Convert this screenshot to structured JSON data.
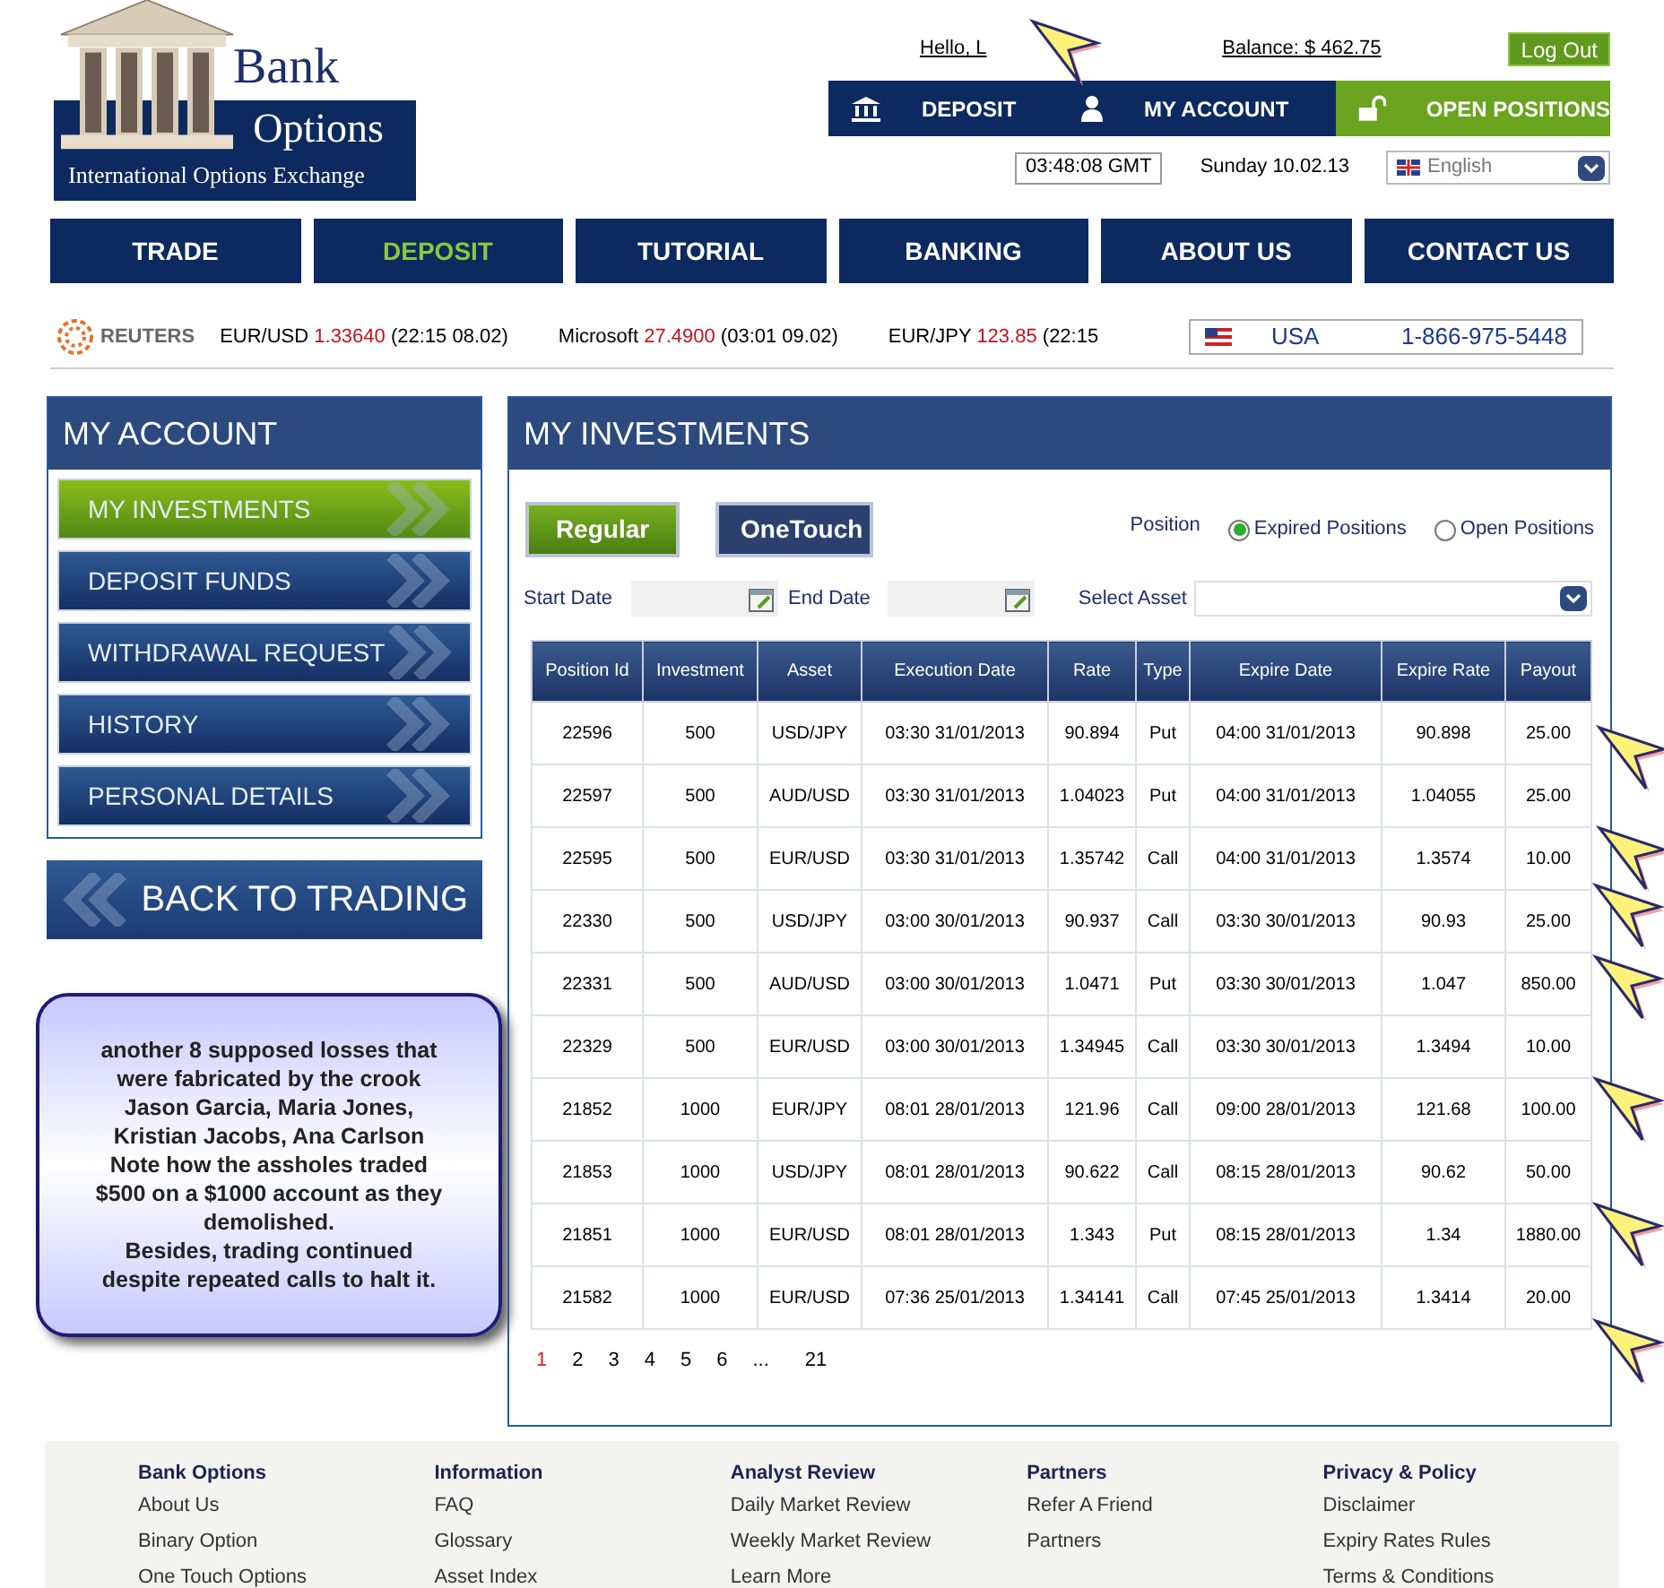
{
  "header": {
    "logo": {
      "title": "Bank",
      "subtitle": "Options",
      "tagline": "International Options Exchange"
    },
    "greeting": "Hello, L",
    "balance": "Balance: $ 462.75",
    "logout": "Log Out",
    "account_nav": [
      {
        "label": "DEPOSIT",
        "kind": "bank",
        "selected": false
      },
      {
        "label": "MY ACCOUNT",
        "kind": "user",
        "selected": false
      },
      {
        "label": "OPEN POSITIONS",
        "kind": "unlock",
        "selected": true
      }
    ],
    "clock": "03:48:08 GMT",
    "date": "Sunday 10.02.13",
    "language": "English"
  },
  "main_nav": [
    {
      "label": "TRADE",
      "selected": false
    },
    {
      "label": "DEPOSIT",
      "selected": true
    },
    {
      "label": "TUTORIAL",
      "selected": false
    },
    {
      "label": "BANKING",
      "selected": false
    },
    {
      "label": "ABOUT US",
      "selected": false
    },
    {
      "label": "CONTACT US",
      "selected": false
    }
  ],
  "ticker": {
    "source": "REUTERS",
    "quotes": [
      {
        "symbol": "EUR/USD",
        "price": "1.33640",
        "time": "(22:15 08.02)"
      },
      {
        "symbol": "Microsoft",
        "price": "27.4900",
        "time": "(03:01 09.02)"
      },
      {
        "symbol": "EUR/JPY",
        "price": "123.85",
        "time": "(22:15"
      }
    ],
    "phone": {
      "country": "USA",
      "number": "1-866-975-5448"
    }
  },
  "sidebar": {
    "title": "MY ACCOUNT",
    "items": [
      {
        "label": "MY INVESTMENTS",
        "selected": true
      },
      {
        "label": "DEPOSIT FUNDS",
        "selected": false
      },
      {
        "label": "WITHDRAWAL REQUEST",
        "selected": false
      },
      {
        "label": "HISTORY",
        "selected": false
      },
      {
        "label": "PERSONAL DETAILS",
        "selected": false
      }
    ],
    "back": "BACK TO TRADING"
  },
  "note": {
    "lines": [
      "another 8 supposed losses that",
      "were fabricated by the crook",
      "Jason Garcia, Maria Jones,",
      "Kristian Jacobs, Ana Carlson",
      "Note how the assholes traded",
      "$500 on a $1000 account as they",
      "demolished.",
      "Besides, trading continued",
      "despite repeated calls to halt it."
    ]
  },
  "investments": {
    "title": "MY INVESTMENTS",
    "tabs": [
      {
        "label": "Regular",
        "selected": true
      },
      {
        "label": "OneTouch",
        "selected": false
      }
    ],
    "position_label": "Position",
    "radios": [
      {
        "label": "Expired Positions",
        "selected": true
      },
      {
        "label": "Open Positions",
        "selected": false
      }
    ],
    "start_date_label": "Start Date",
    "end_date_label": "End Date",
    "asset_label": "Select Asset",
    "table": {
      "columns": [
        "Position Id",
        "Investment",
        "Asset",
        "Execution Date",
        "Rate",
        "Type",
        "Expire Date",
        "Expire Rate",
        "Payout"
      ],
      "rows": [
        [
          "22596",
          "500",
          "USD/JPY",
          "03:30 31/01/2013",
          "90.894",
          "Put",
          "04:00 31/01/2013",
          "90.898",
          "25.00"
        ],
        [
          "22597",
          "500",
          "AUD/USD",
          "03:30 31/01/2013",
          "1.04023",
          "Put",
          "04:00 31/01/2013",
          "1.04055",
          "25.00"
        ],
        [
          "22595",
          "500",
          "EUR/USD",
          "03:30 31/01/2013",
          "1.35742",
          "Call",
          "04:00 31/01/2013",
          "1.3574",
          "10.00"
        ],
        [
          "22330",
          "500",
          "USD/JPY",
          "03:00 30/01/2013",
          "90.937",
          "Call",
          "03:30 30/01/2013",
          "90.93",
          "25.00"
        ],
        [
          "22331",
          "500",
          "AUD/USD",
          "03:00 30/01/2013",
          "1.0471",
          "Put",
          "03:30 30/01/2013",
          "1.047",
          "850.00"
        ],
        [
          "22329",
          "500",
          "EUR/USD",
          "03:00 30/01/2013",
          "1.34945",
          "Call",
          "03:30 30/01/2013",
          "1.3494",
          "10.00"
        ],
        [
          "21852",
          "1000",
          "EUR/JPY",
          "08:01 28/01/2013",
          "121.96",
          "Call",
          "09:00 28/01/2013",
          "121.68",
          "100.00"
        ],
        [
          "21853",
          "1000",
          "USD/JPY",
          "08:01 28/01/2013",
          "90.622",
          "Call",
          "08:15 28/01/2013",
          "90.62",
          "50.00"
        ],
        [
          "21851",
          "1000",
          "EUR/USD",
          "08:01 28/01/2013",
          "1.343",
          "Put",
          "08:15 28/01/2013",
          "1.34",
          "1880.00"
        ],
        [
          "21582",
          "1000",
          "EUR/USD",
          "07:36 25/01/2013",
          "1.34141",
          "Call",
          "07:45 25/01/2013",
          "1.3414",
          "20.00"
        ]
      ]
    },
    "pages": [
      {
        "label": "1",
        "selected": true
      },
      {
        "label": "2",
        "selected": false
      },
      {
        "label": "3",
        "selected": false
      },
      {
        "label": "4",
        "selected": false
      },
      {
        "label": "5",
        "selected": false
      },
      {
        "label": "6",
        "selected": false
      },
      {
        "label": "...",
        "selected": false
      },
      {
        "label": "21",
        "selected": false
      }
    ]
  },
  "footer": [
    {
      "title": "Bank Options",
      "links": [
        "About Us",
        "Binary Option",
        "One Touch Options"
      ]
    },
    {
      "title": "Information",
      "links": [
        "FAQ",
        "Glossary",
        "Asset Index"
      ]
    },
    {
      "title": "Analyst Review",
      "links": [
        "Daily Market Review",
        "Weekly Market Review",
        "Learn More"
      ]
    },
    {
      "title": "Partners",
      "links": [
        "Refer A Friend",
        "Partners"
      ]
    },
    {
      "title": "Privacy & Policy",
      "links": [
        "Disclaimer",
        "Expiry Rates Rules",
        "Terms & Conditions"
      ]
    }
  ]
}
